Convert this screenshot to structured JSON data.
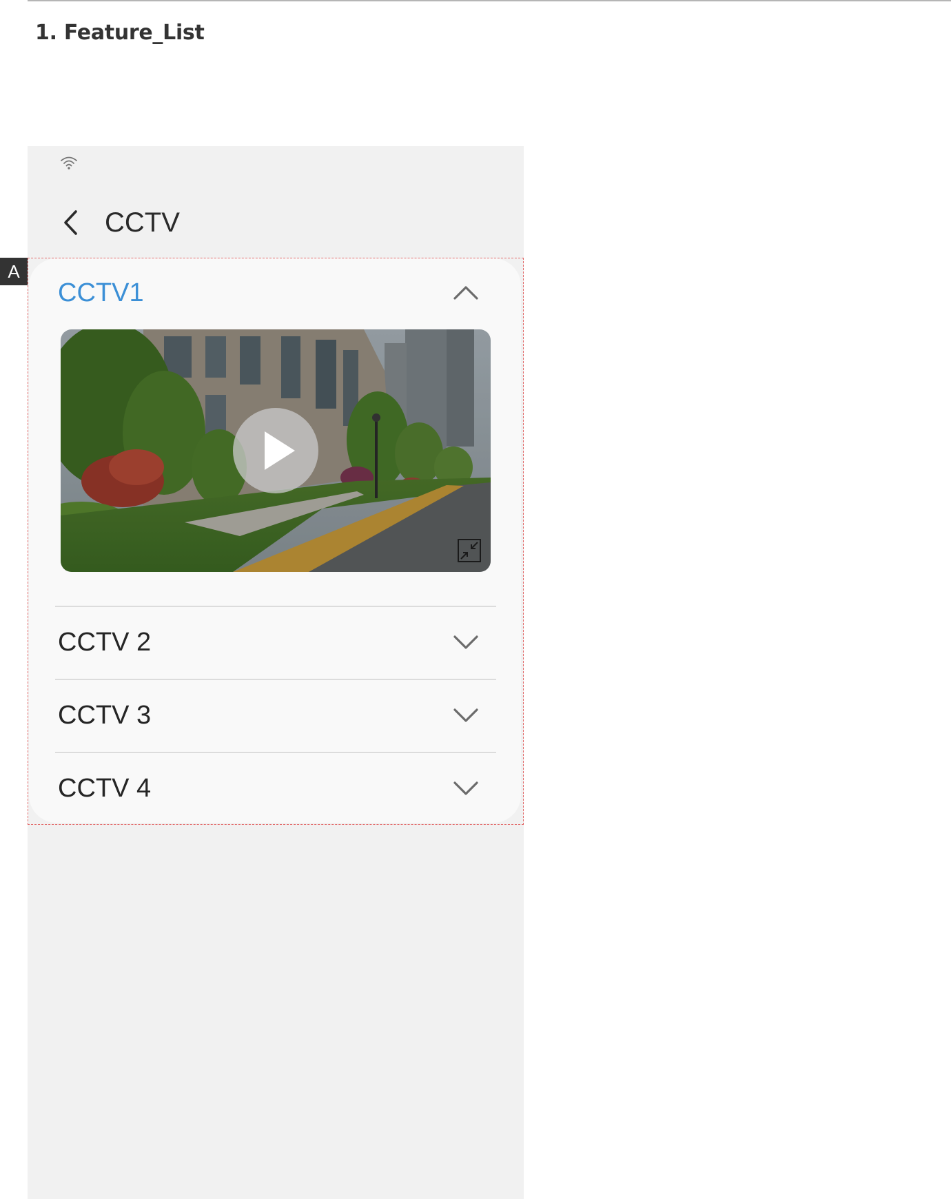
{
  "document": {
    "section_title": "1. Feature_List",
    "marker_label": "A"
  },
  "app_bar": {
    "title": "CCTV",
    "back_icon": "chevron-left-icon"
  },
  "status_bar": {
    "icons": [
      "wifi-icon"
    ]
  },
  "cctv_list": {
    "items": [
      {
        "label": "CCTV1",
        "expanded": true,
        "icon": "chevron-up-icon"
      },
      {
        "label": "CCTV 2",
        "expanded": false,
        "icon": "chevron-down-icon"
      },
      {
        "label": "CCTV 3",
        "expanded": false,
        "icon": "chevron-down-icon"
      },
      {
        "label": "CCTV 4",
        "expanded": false,
        "icon": "chevron-down-icon"
      }
    ],
    "video": {
      "play_icon": "play-icon",
      "collapse_icon": "exit-fullscreen-icon"
    }
  },
  "colors": {
    "accent": "#3b8fd6",
    "screen_background": "#f1f1f1",
    "card_background": "#f9f9f9",
    "annotation_border": "#e36a6a"
  }
}
